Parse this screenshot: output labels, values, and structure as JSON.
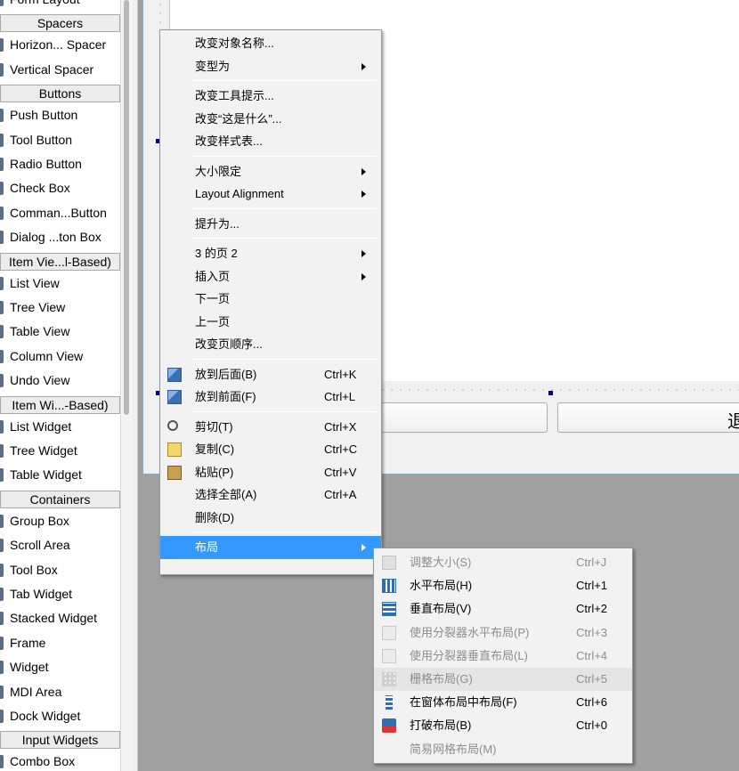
{
  "widget_box": {
    "rows": [
      {
        "kind": "item",
        "label": "Form Layout",
        "icon": "form-layout-icon"
      },
      {
        "kind": "category",
        "label": "Spacers"
      },
      {
        "kind": "item",
        "label": "Horizon... Spacer",
        "icon": "horizontal-spacer-icon"
      },
      {
        "kind": "item",
        "label": "Vertical Spacer",
        "icon": "vertical-spacer-icon"
      },
      {
        "kind": "category",
        "label": "Buttons"
      },
      {
        "kind": "item",
        "label": "Push Button",
        "icon": "push-button-icon"
      },
      {
        "kind": "item",
        "label": "Tool Button",
        "icon": "tool-button-icon"
      },
      {
        "kind": "item",
        "label": "Radio Button",
        "icon": "radio-button-icon"
      },
      {
        "kind": "item",
        "label": "Check Box",
        "icon": "check-box-icon"
      },
      {
        "kind": "item",
        "label": "Comman...Button",
        "icon": "command-link-button-icon"
      },
      {
        "kind": "item",
        "label": "Dialog ...ton Box",
        "icon": "dialog-button-box-icon"
      },
      {
        "kind": "category",
        "label": "Item Vie...l-Based)"
      },
      {
        "kind": "item",
        "label": "List View",
        "icon": "list-view-icon"
      },
      {
        "kind": "item",
        "label": "Tree View",
        "icon": "tree-view-icon"
      },
      {
        "kind": "item",
        "label": "Table View",
        "icon": "table-view-icon"
      },
      {
        "kind": "item",
        "label": "Column View",
        "icon": "column-view-icon"
      },
      {
        "kind": "item",
        "label": "Undo View",
        "icon": "undo-view-icon"
      },
      {
        "kind": "category",
        "label": "Item Wi...-Based)"
      },
      {
        "kind": "item",
        "label": "List Widget",
        "icon": "list-widget-icon"
      },
      {
        "kind": "item",
        "label": "Tree Widget",
        "icon": "tree-widget-icon"
      },
      {
        "kind": "item",
        "label": "Table Widget",
        "icon": "table-widget-icon"
      },
      {
        "kind": "category",
        "label": "Containers"
      },
      {
        "kind": "item",
        "label": "Group Box",
        "icon": "group-box-icon"
      },
      {
        "kind": "item",
        "label": "Scroll Area",
        "icon": "scroll-area-icon"
      },
      {
        "kind": "item",
        "label": "Tool Box",
        "icon": "tool-box-icon"
      },
      {
        "kind": "item",
        "label": "Tab Widget",
        "icon": "tab-widget-icon"
      },
      {
        "kind": "item",
        "label": "Stacked Widget",
        "icon": "stacked-widget-icon"
      },
      {
        "kind": "item",
        "label": "Frame",
        "icon": "frame-icon"
      },
      {
        "kind": "item",
        "label": "Widget",
        "icon": "widget-icon"
      },
      {
        "kind": "item",
        "label": "MDI Area",
        "icon": "mdi-area-icon"
      },
      {
        "kind": "item",
        "label": "Dock Widget",
        "icon": "dock-widget-icon"
      },
      {
        "kind": "category",
        "label": "Input Widgets"
      },
      {
        "kind": "item",
        "label": "Combo Box",
        "icon": "combo-box-icon"
      }
    ]
  },
  "form": {
    "button_text": "退"
  },
  "context_menu": {
    "items": [
      {
        "type": "item",
        "label": "改变对象名称..."
      },
      {
        "type": "item",
        "label": "变型为",
        "submenu": true
      },
      {
        "type": "separator"
      },
      {
        "type": "item",
        "label": "改变工具提示..."
      },
      {
        "type": "item",
        "label": "改变“这是什么”..."
      },
      {
        "type": "item",
        "label": "改变样式表..."
      },
      {
        "type": "separator"
      },
      {
        "type": "item",
        "label": "大小限定",
        "submenu": true
      },
      {
        "type": "item",
        "label": "Layout Alignment",
        "submenu": true
      },
      {
        "type": "separator"
      },
      {
        "type": "item",
        "label": "提升为..."
      },
      {
        "type": "separator"
      },
      {
        "type": "item",
        "label": "3 的页 2",
        "submenu": true
      },
      {
        "type": "item",
        "label": "插入页",
        "submenu": true
      },
      {
        "type": "item",
        "label": "下一页"
      },
      {
        "type": "item",
        "label": "上一页"
      },
      {
        "type": "item",
        "label": "改变页顺序..."
      },
      {
        "type": "separator"
      },
      {
        "type": "item",
        "label": "放到后面(B)",
        "shortcut": "Ctrl+K",
        "icon": "send-to-back-icon"
      },
      {
        "type": "item",
        "label": "放到前面(F)",
        "shortcut": "Ctrl+L",
        "icon": "bring-to-front-icon"
      },
      {
        "type": "separator"
      },
      {
        "type": "item",
        "label": "剪切(T)",
        "shortcut": "Ctrl+X",
        "icon": "cut-icon"
      },
      {
        "type": "item",
        "label": "复制(C)",
        "shortcut": "Ctrl+C",
        "icon": "copy-icon"
      },
      {
        "type": "item",
        "label": "粘贴(P)",
        "shortcut": "Ctrl+V",
        "icon": "paste-icon"
      },
      {
        "type": "item",
        "label": "选择全部(A)",
        "shortcut": "Ctrl+A"
      },
      {
        "type": "item",
        "label": "删除(D)"
      },
      {
        "type": "separator"
      },
      {
        "type": "item",
        "label": "布局",
        "submenu": true,
        "highlighted": true
      }
    ]
  },
  "layout_submenu": {
    "items": [
      {
        "label": "调整大小(S)",
        "shortcut": "Ctrl+J",
        "disabled": true,
        "icon": "adjust-size-icon"
      },
      {
        "label": "水平布局(H)",
        "shortcut": "Ctrl+1",
        "disabled": false,
        "icon": "horizontal-layout-icon"
      },
      {
        "label": "垂直布局(V)",
        "shortcut": "Ctrl+2",
        "disabled": false,
        "icon": "vertical-layout-icon"
      },
      {
        "label": "使用分裂器水平布局(P)",
        "shortcut": "Ctrl+3",
        "disabled": true,
        "icon": "horizontal-splitter-icon"
      },
      {
        "label": "使用分裂器垂直布局(L)",
        "shortcut": "Ctrl+4",
        "disabled": true,
        "icon": "vertical-splitter-icon"
      },
      {
        "label": "栅格布局(G)",
        "shortcut": "Ctrl+5",
        "disabled": true,
        "hover": true,
        "icon": "grid-layout-icon"
      },
      {
        "label": "在窗体布局中布局(F)",
        "shortcut": "Ctrl+6",
        "disabled": false,
        "icon": "form-layout-icon"
      },
      {
        "label": "打破布局(B)",
        "shortcut": "Ctrl+0",
        "disabled": false,
        "icon": "break-layout-icon"
      },
      {
        "label": "简易网格布局(M)",
        "shortcut": "",
        "disabled": true
      }
    ]
  },
  "colors": {
    "menu_highlight": "#3399ff",
    "menu_background": "#f2f2f2",
    "disabled_text": "#8d8d8d",
    "canvas_gray": "#a0a0a0"
  }
}
